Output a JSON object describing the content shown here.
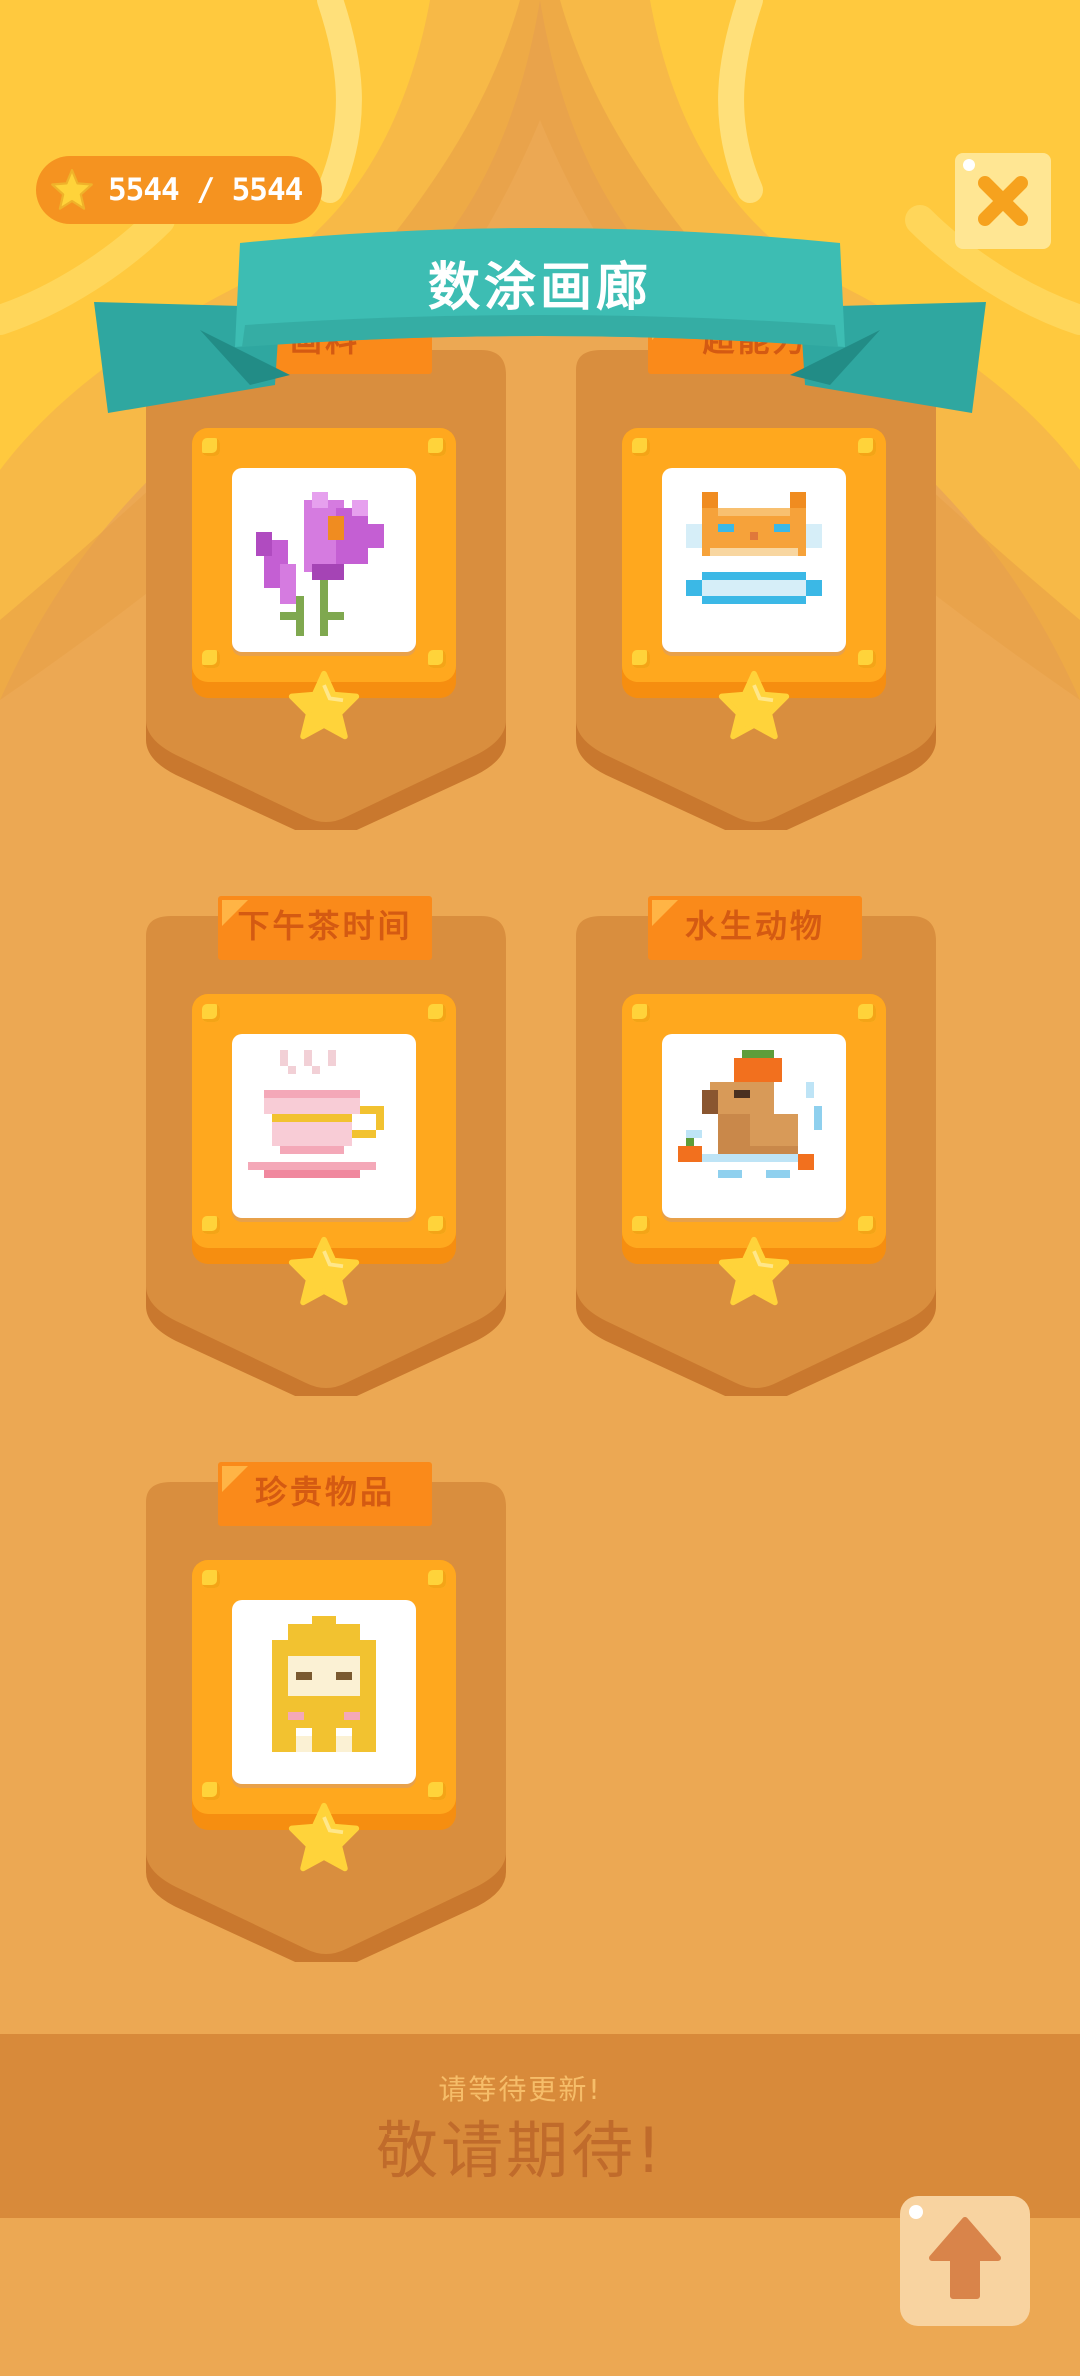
{
  "stars": {
    "label": "5544 / 5544",
    "icon": "star-icon"
  },
  "close_icon": "close-icon",
  "title": "数涂画廊",
  "categories": [
    {
      "name": "画料",
      "picture": "purple-flowers",
      "icon": "star-badge-icon"
    },
    {
      "name": "超能力",
      "picture": "cat-with-halo",
      "icon": "star-badge-icon"
    },
    {
      "name": "下午茶时间",
      "picture": "teacup",
      "icon": "star-badge-icon"
    },
    {
      "name": "水生动物",
      "picture": "capybara-with-tangerine",
      "icon": "star-badge-icon"
    },
    {
      "name": "珍贵物品",
      "picture": "golden-figure",
      "icon": "star-badge-icon"
    }
  ],
  "coming_soon": {
    "subtitle": "请等待更新!",
    "title": "敬请期待!"
  },
  "scroll_top_icon": "arrow-up-icon",
  "colors": {
    "background": "#ECA853",
    "accent_orange": "#F59320",
    "banner_teal": "#3DBDB3",
    "card_brown": "#D98E3E",
    "star_yellow": "#FFD33A"
  }
}
